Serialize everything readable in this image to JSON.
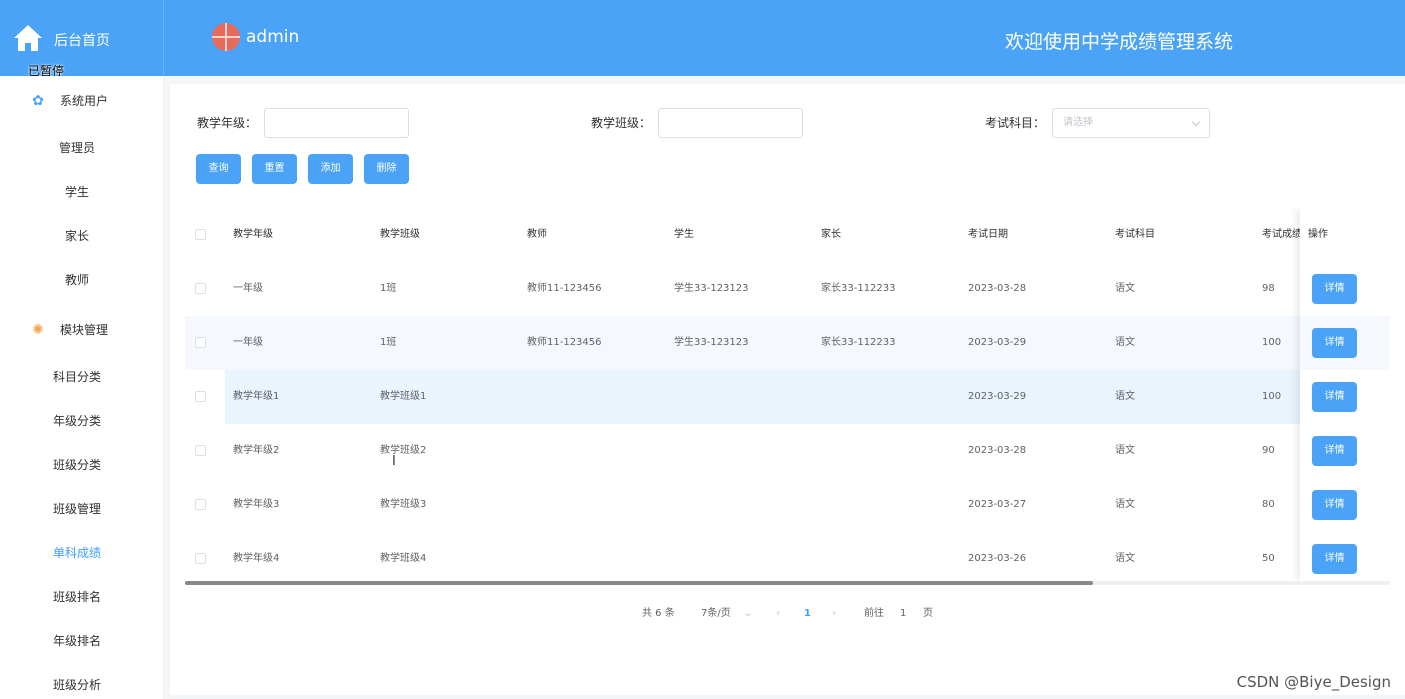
{
  "header": {
    "brand": "后台首页",
    "paused_badge": "已暂停",
    "username": "admin",
    "system_title": "欢迎使用中学成绩管理系统"
  },
  "sidebar": {
    "groups": [
      {
        "label": "系统用户",
        "icon": "star-icon",
        "items": [
          "管理员",
          "学生",
          "家长",
          "教师"
        ]
      },
      {
        "label": "模块管理",
        "icon": "gear-icon",
        "items": [
          "科目分类",
          "年级分类",
          "班级分类",
          "班级管理",
          "单科成绩",
          "班级排名",
          "年级排名",
          "班级分析"
        ]
      }
    ],
    "active": "单科成绩"
  },
  "search": {
    "grade_label": "教学年级：",
    "class_label": "教学班级：",
    "subject_label": "考试科目：",
    "subject_placeholder": "请选择"
  },
  "buttons": {
    "query": "查询",
    "reset": "重置",
    "add": "添加",
    "delete": "删除"
  },
  "table": {
    "columns": [
      "教学年级",
      "教学班级",
      "教师",
      "学生",
      "家长",
      "考试日期",
      "考试科目",
      "考试成绩",
      "操作"
    ],
    "rows": [
      [
        "一年级",
        "1班",
        "教师11-123456",
        "学生33-123123",
        "家长33-112233",
        "2023-03-28",
        "语文",
        "98"
      ],
      [
        "一年级",
        "1班",
        "教师11-123456",
        "学生33-123123",
        "家长33-112233",
        "2023-03-29",
        "语文",
        "100"
      ],
      [
        "教学年级1",
        "教学班级1",
        "",
        "",
        "",
        "2023-03-29",
        "语文",
        "100"
      ],
      [
        "教学年级2",
        "教学班级2",
        "",
        "",
        "",
        "2023-03-28",
        "语文",
        "90"
      ],
      [
        "教学年级3",
        "教学班级3",
        "",
        "",
        "",
        "2023-03-27",
        "语文",
        "80"
      ],
      [
        "教学年级4",
        "教学班级4",
        "",
        "",
        "",
        "2023-03-26",
        "语文",
        "50"
      ]
    ],
    "detail_label": "详情"
  },
  "pagination": {
    "total": "共 6 条",
    "page_size": "7条/页",
    "current_page": "1",
    "goto_label": "前往",
    "goto_value": "1",
    "page_suffix": "页"
  },
  "watermark": "CSDN @Biye_Design",
  "colors": {
    "primary": "#4aa3f7",
    "active_text": "#409eff"
  }
}
